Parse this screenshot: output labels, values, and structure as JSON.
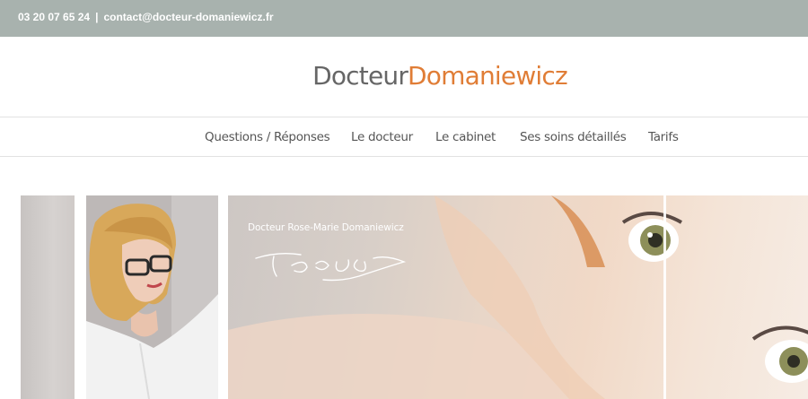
{
  "topbar": {
    "phone": "03 20 07 65 24",
    "separator": "|",
    "email": "contact@docteur-domaniewicz.fr",
    "background": "#a8b2ae"
  },
  "logo": {
    "part1": "Docteur",
    "part2": "Domaniewicz",
    "color1": "#666666",
    "color2": "#e07d36"
  },
  "nav": {
    "items": [
      {
        "label": "Questions / Réponses"
      },
      {
        "label": "Le docteur"
      },
      {
        "label": "Le cabinet"
      },
      {
        "label": "Ses soins détaillés"
      },
      {
        "label": "Tarifs"
      }
    ]
  },
  "hero": {
    "doctor_name": "Docteur Rose-Marie Domaniewicz",
    "signature_icon": "signature-icon"
  }
}
